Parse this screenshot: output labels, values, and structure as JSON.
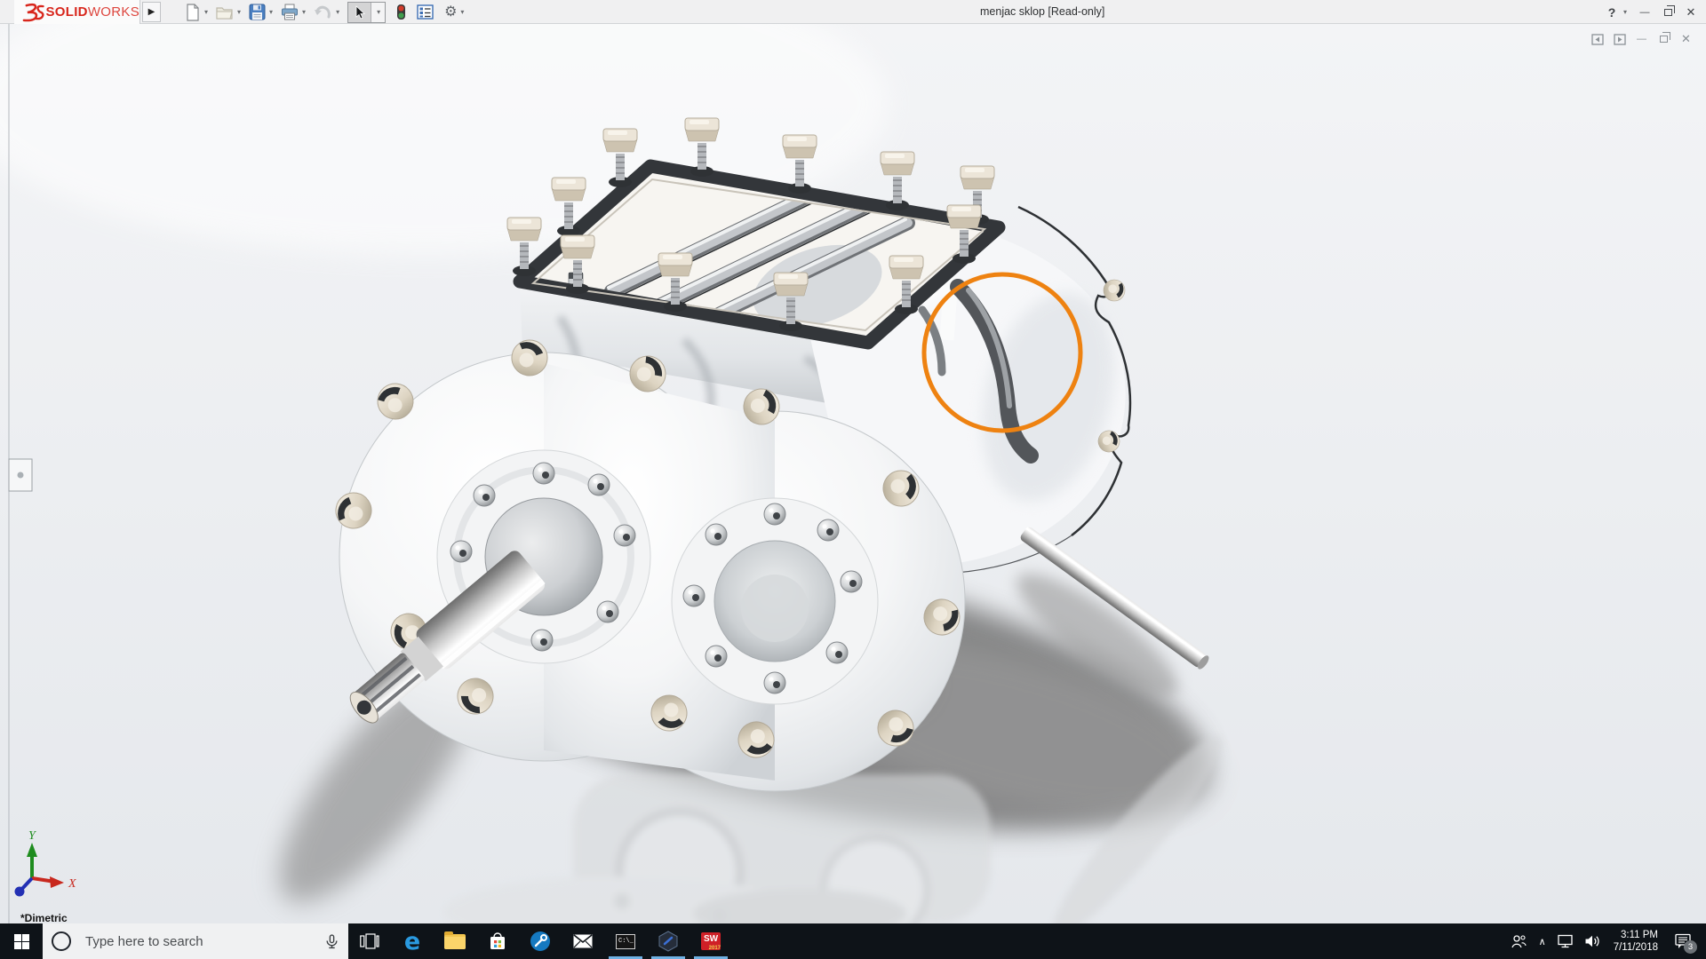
{
  "window": {
    "brand": {
      "solid": "SOLID",
      "works": "WORKS"
    },
    "title": "menjac sklop [Read-only]"
  },
  "icons": {
    "expander": "▶",
    "caret": "▾",
    "help": "?",
    "minimize": "—",
    "close": "✕",
    "chevron_up": "∧",
    "edge": "e",
    "cmd_prompt": "C:\\_",
    "gear": "⚙"
  },
  "toolbar": {
    "items": [
      "new",
      "open",
      "save",
      "print",
      "undo",
      "select",
      "view-safety",
      "display-pane",
      "options"
    ]
  },
  "viewport": {
    "orientation_label": "*Dimetric",
    "annotation_color": "#ee8211",
    "triad": {
      "x": "X",
      "y": "Y",
      "x_color": "#c8281e",
      "y_color": "#1e8c1e",
      "z_color": "#2330b4"
    }
  },
  "taskbar": {
    "search_placeholder": "Type here to search",
    "apps": [
      "task-view",
      "edge",
      "file-explorer",
      "store",
      "settings-tool",
      "mail",
      "command-prompt",
      "hex-app",
      "solidworks-2017"
    ],
    "solidworks_badge": {
      "top": "SW",
      "year": "2017"
    },
    "clock": {
      "time": "3:11 PM",
      "date": "7/11/2018"
    },
    "notification_count": "3"
  }
}
